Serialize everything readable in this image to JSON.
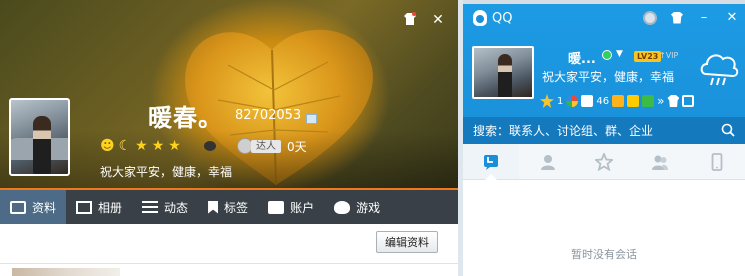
{
  "profile": {
    "nickname": "暖春。",
    "qq_number": "82702053",
    "signature": "祝大家平安，健康，幸福",
    "daren_label": "达人",
    "daren_days": "0天",
    "level_icons": [
      "sun-icon",
      "moon-icon",
      "star-icon",
      "star-icon",
      "star-icon"
    ],
    "window_controls": {
      "skin": "shirt-icon",
      "close": "✕"
    },
    "tabs": [
      {
        "label": "资料",
        "icon": "id-card-icon"
      },
      {
        "label": "相册",
        "icon": "photo-icon"
      },
      {
        "label": "动态",
        "icon": "list-icon"
      },
      {
        "label": "标签",
        "icon": "bookmark-icon"
      },
      {
        "label": "账户",
        "icon": "wallet-icon"
      },
      {
        "label": "游戏",
        "icon": "gamepad-icon"
      }
    ],
    "active_tab": "资料",
    "edit_button": "编辑资料"
  },
  "qq_panel": {
    "title": "QQ",
    "controls": {
      "medal": "medal-icon",
      "minimize": "–",
      "close": "✕"
    },
    "nickname": "暖...",
    "status": "online",
    "level_badge": "LV23",
    "vip_label": "VIP",
    "signature": "祝大家平安，健康，幸福",
    "quick_icons": [
      {
        "icon": "star-icon",
        "count": "1"
      },
      {
        "icon": "color-circle-icon",
        "count": ""
      },
      {
        "icon": "mail-icon",
        "count": "46"
      },
      {
        "icon": "cart-icon",
        "count": ""
      },
      {
        "icon": "wallet-icon",
        "count": ""
      },
      {
        "icon": "green-app-icon",
        "count": ""
      }
    ],
    "search_placeholder": "搜索：联系人、讨论组、群、企业",
    "tabs": [
      "message-icon",
      "contact-icon",
      "star-icon",
      "group-icon",
      "phone-icon"
    ],
    "empty_text": "暂时没有会话"
  },
  "colors": {
    "accent_blue": "#1a8fd9",
    "tab_bar": "#3a4047",
    "active_tab": "#4d6a86",
    "orange_line": "#f07a1b"
  }
}
